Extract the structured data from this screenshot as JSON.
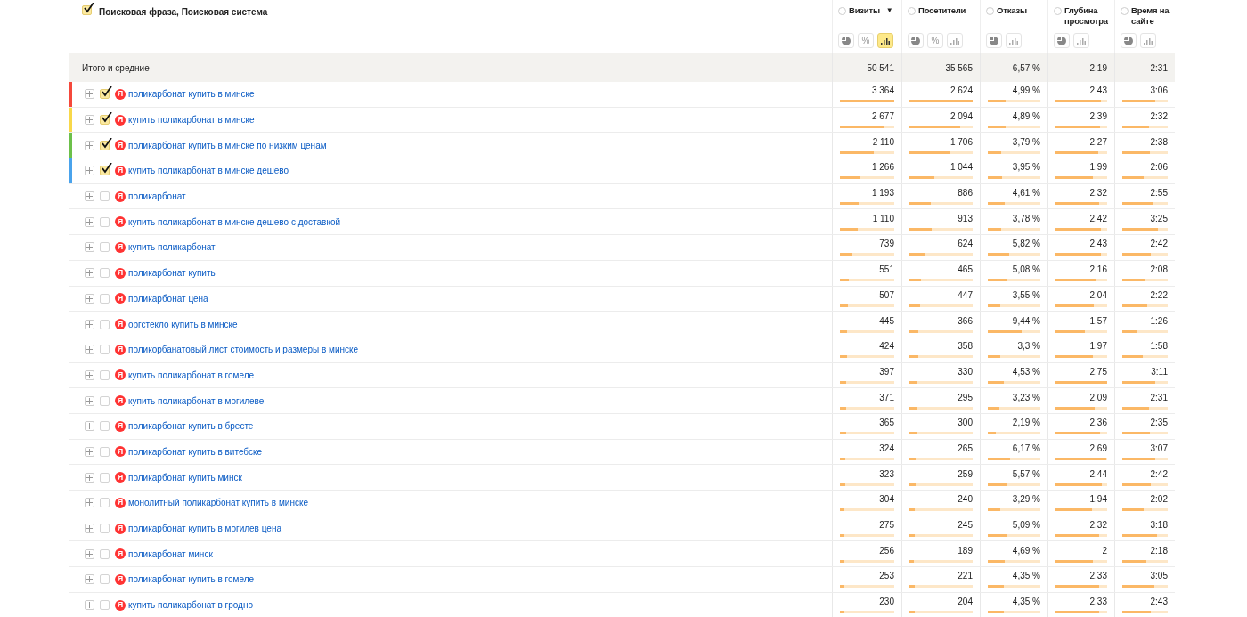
{
  "header": {
    "dimension": {
      "label": "Поисковая фраза, Поисковая система",
      "checked": true
    },
    "columns": [
      {
        "label": "Визиты",
        "sort_mark": "▼",
        "views": [
          {
            "kind": "pie",
            "selected": false
          },
          {
            "kind": "percent",
            "text": "%",
            "selected": false
          },
          {
            "kind": "bars",
            "selected": true
          }
        ]
      },
      {
        "label": "Посетители",
        "views": [
          {
            "kind": "pie",
            "selected": false
          },
          {
            "kind": "percent",
            "text": "%",
            "selected": false
          },
          {
            "kind": "bars",
            "selected": false
          }
        ]
      },
      {
        "label": "Отказы",
        "views": [
          {
            "kind": "pie",
            "selected": false
          },
          {
            "kind": "bars",
            "selected": false
          }
        ]
      },
      {
        "label": "Глубина просмотра",
        "views": [
          {
            "kind": "pie",
            "selected": false
          },
          {
            "kind": "bars",
            "selected": false
          }
        ]
      },
      {
        "label": "Время на сайте",
        "views": [
          {
            "kind": "pie",
            "selected": false
          },
          {
            "kind": "bars",
            "selected": false
          }
        ]
      }
    ]
  },
  "totals": {
    "label": "Итого и средние",
    "values": [
      "50 541",
      "35 565",
      "6,57 %",
      "2,19",
      "2:31"
    ]
  },
  "rows": [
    {
      "phrase": "поликарбонат купить в минске",
      "engine_glyph": "Я",
      "checked": true,
      "color": "#f5483b",
      "cells": [
        {
          "text": "3 364",
          "level": 1
        },
        {
          "text": "2 624",
          "level": 1
        },
        {
          "text": "4,99 %",
          "level": 0.34
        },
        {
          "text": "2,43",
          "level": 0.88
        },
        {
          "text": "3:06",
          "level": 0.72
        }
      ]
    },
    {
      "phrase": "купить поликарбонат в минске",
      "engine_glyph": "Я",
      "checked": true,
      "color": "#f8d84a",
      "cells": [
        {
          "text": "2 677",
          "level": 0.8
        },
        {
          "text": "2 094",
          "level": 0.8
        },
        {
          "text": "4,89 %",
          "level": 0.34
        },
        {
          "text": "2,39",
          "level": 0.87
        },
        {
          "text": "2:32",
          "level": 0.58
        }
      ]
    },
    {
      "phrase": "поликарбонат купить в минске по низким ценам",
      "engine_glyph": "Я",
      "checked": true,
      "color": "#6cc04a",
      "cells": [
        {
          "text": "2 110",
          "level": 0.63
        },
        {
          "text": "1 706",
          "level": 0.65
        },
        {
          "text": "3,79 %",
          "level": 0.26
        },
        {
          "text": "2,27",
          "level": 0.83
        },
        {
          "text": "2:38",
          "level": 0.61
        }
      ]
    },
    {
      "phrase": "купить поликарбонат в минске дешево",
      "engine_glyph": "Я",
      "checked": true,
      "color": "#4aa3ec",
      "cells": [
        {
          "text": "1 266",
          "level": 0.38
        },
        {
          "text": "1 044",
          "level": 0.4
        },
        {
          "text": "3,95 %",
          "level": 0.27
        },
        {
          "text": "1,99",
          "level": 0.72
        },
        {
          "text": "2:06",
          "level": 0.48
        }
      ]
    },
    {
      "phrase": "поликарбонат",
      "engine_glyph": "Я",
      "checked": false,
      "cells": [
        {
          "text": "1 193",
          "level": 0.35
        },
        {
          "text": "886",
          "level": 0.34
        },
        {
          "text": "4,61 %",
          "level": 0.32
        },
        {
          "text": "2,32",
          "level": 0.84
        },
        {
          "text": "2:55",
          "level": 0.67
        }
      ]
    },
    {
      "phrase": "купить поликарбонат в минске дешево с доставкой",
      "engine_glyph": "Я",
      "checked": false,
      "cells": [
        {
          "text": "1 110",
          "level": 0.33
        },
        {
          "text": "913",
          "level": 0.35
        },
        {
          "text": "3,78 %",
          "level": 0.26
        },
        {
          "text": "2,42",
          "level": 0.88
        },
        {
          "text": "3:25",
          "level": 0.79
        }
      ]
    },
    {
      "phrase": "купить поликарбонат",
      "engine_glyph": "Я",
      "checked": false,
      "cells": [
        {
          "text": "739",
          "level": 0.22
        },
        {
          "text": "624",
          "level": 0.24
        },
        {
          "text": "5,82 %",
          "level": 0.4
        },
        {
          "text": "2,43",
          "level": 0.88
        },
        {
          "text": "2:42",
          "level": 0.62
        }
      ]
    },
    {
      "phrase": "поликарбонат купить",
      "engine_glyph": "Я",
      "checked": false,
      "cells": [
        {
          "text": "551",
          "level": 0.16
        },
        {
          "text": "465",
          "level": 0.18
        },
        {
          "text": "5,08 %",
          "level": 0.35
        },
        {
          "text": "2,16",
          "level": 0.79
        },
        {
          "text": "2:08",
          "level": 0.49
        }
      ]
    },
    {
      "phrase": "поликарбонат цена",
      "engine_glyph": "Я",
      "checked": false,
      "cells": [
        {
          "text": "507",
          "level": 0.15
        },
        {
          "text": "447",
          "level": 0.17
        },
        {
          "text": "3,55 %",
          "level": 0.24
        },
        {
          "text": "2,04",
          "level": 0.74
        },
        {
          "text": "2:22",
          "level": 0.55
        }
      ]
    },
    {
      "phrase": "оргстекло купить в минске",
      "engine_glyph": "Я",
      "checked": false,
      "cells": [
        {
          "text": "445",
          "level": 0.13
        },
        {
          "text": "366",
          "level": 0.14
        },
        {
          "text": "9,44 %",
          "level": 0.65
        },
        {
          "text": "1,57",
          "level": 0.57
        },
        {
          "text": "1:26",
          "level": 0.33
        }
      ]
    },
    {
      "phrase": "поликорбанатовый лист стоимость и размеры в минске",
      "engine_glyph": "Я",
      "checked": false,
      "cells": [
        {
          "text": "424",
          "level": 0.13
        },
        {
          "text": "358",
          "level": 0.14
        },
        {
          "text": "3,3 %",
          "level": 0.23
        },
        {
          "text": "1,97",
          "level": 0.72
        },
        {
          "text": "1:58",
          "level": 0.45
        }
      ]
    },
    {
      "phrase": "купить поликарбонат в гомеле",
      "engine_glyph": "Я",
      "checked": false,
      "cells": [
        {
          "text": "397",
          "level": 0.12
        },
        {
          "text": "330",
          "level": 0.13
        },
        {
          "text": "4,53 %",
          "level": 0.31
        },
        {
          "text": "2,75",
          "level": 1
        },
        {
          "text": "3:11",
          "level": 0.73
        }
      ]
    },
    {
      "phrase": "купить поликарбонат в могилеве",
      "engine_glyph": "Я",
      "checked": false,
      "cells": [
        {
          "text": "371",
          "level": 0.11
        },
        {
          "text": "295",
          "level": 0.11
        },
        {
          "text": "3,23 %",
          "level": 0.22
        },
        {
          "text": "2,09",
          "level": 0.76
        },
        {
          "text": "2:31",
          "level": 0.58
        }
      ]
    },
    {
      "phrase": "поликарбонат купить в бресте",
      "engine_glyph": "Я",
      "checked": false,
      "cells": [
        {
          "text": "365",
          "level": 0.11
        },
        {
          "text": "300",
          "level": 0.11
        },
        {
          "text": "2,19 %",
          "level": 0.15
        },
        {
          "text": "2,36",
          "level": 0.86
        },
        {
          "text": "2:35",
          "level": 0.6
        }
      ]
    },
    {
      "phrase": "поликарбонат купить в витебске",
      "engine_glyph": "Я",
      "checked": false,
      "cells": [
        {
          "text": "324",
          "level": 0.1
        },
        {
          "text": "265",
          "level": 0.1
        },
        {
          "text": "6,17 %",
          "level": 0.43
        },
        {
          "text": "2,69",
          "level": 0.98
        },
        {
          "text": "3:07",
          "level": 0.72
        }
      ]
    },
    {
      "phrase": "поликарбонат купить минск",
      "engine_glyph": "Я",
      "checked": false,
      "cells": [
        {
          "text": "323",
          "level": 0.1
        },
        {
          "text": "259",
          "level": 0.1
        },
        {
          "text": "5,57 %",
          "level": 0.38
        },
        {
          "text": "2,44",
          "level": 0.89
        },
        {
          "text": "2:42",
          "level": 0.62
        }
      ]
    },
    {
      "phrase": "монолитный поликарбонат купить в минске",
      "engine_glyph": "Я",
      "checked": false,
      "cells": [
        {
          "text": "304",
          "level": 0.09
        },
        {
          "text": "240",
          "level": 0.09
        },
        {
          "text": "3,29 %",
          "level": 0.23
        },
        {
          "text": "1,94",
          "level": 0.71
        },
        {
          "text": "2:02",
          "level": 0.47
        }
      ]
    },
    {
      "phrase": "поликарбонат купить в могилев цена",
      "engine_glyph": "Я",
      "checked": false,
      "cells": [
        {
          "text": "275",
          "level": 0.08
        },
        {
          "text": "245",
          "level": 0.09
        },
        {
          "text": "5,09 %",
          "level": 0.35
        },
        {
          "text": "2,32",
          "level": 0.84
        },
        {
          "text": "3:18",
          "level": 0.76
        }
      ]
    },
    {
      "phrase": "поликарбонат минск",
      "engine_glyph": "Я",
      "checked": false,
      "cells": [
        {
          "text": "256",
          "level": 0.08
        },
        {
          "text": "189",
          "level": 0.07
        },
        {
          "text": "4,69 %",
          "level": 0.32
        },
        {
          "text": "2",
          "level": 0.73
        },
        {
          "text": "2:18",
          "level": 0.53
        }
      ]
    },
    {
      "phrase": "поликарбонат купить в гомеле",
      "engine_glyph": "Я",
      "checked": false,
      "cells": [
        {
          "text": "253",
          "level": 0.08
        },
        {
          "text": "221",
          "level": 0.08
        },
        {
          "text": "4,35 %",
          "level": 0.3
        },
        {
          "text": "2,33",
          "level": 0.85
        },
        {
          "text": "3:05",
          "level": 0.71
        }
      ]
    },
    {
      "phrase": "купить поликарбонат в гродно",
      "engine_glyph": "Я",
      "checked": false,
      "cells": [
        {
          "text": "230",
          "level": 0.07
        },
        {
          "text": "204",
          "level": 0.08
        },
        {
          "text": "4,35 %",
          "level": 0.3
        },
        {
          "text": "2,33",
          "level": 0.85
        },
        {
          "text": "2:43",
          "level": 0.63
        }
      ]
    }
  ]
}
